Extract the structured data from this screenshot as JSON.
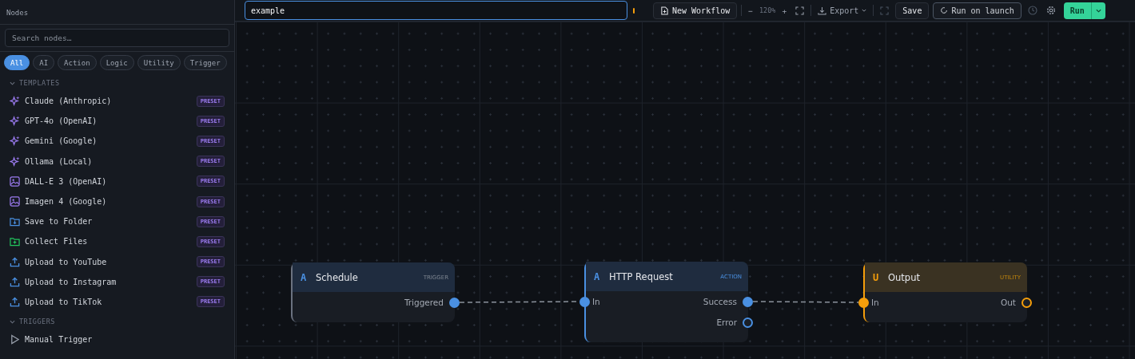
{
  "sidebar": {
    "title": "Nodes",
    "search": {
      "placeholder": "Search nodes…"
    },
    "filters": [
      {
        "label": "All",
        "selected": true
      },
      {
        "label": "AI",
        "selected": false
      },
      {
        "label": "Action",
        "selected": false
      },
      {
        "label": "Logic",
        "selected": false
      },
      {
        "label": "Utility",
        "selected": false
      },
      {
        "label": "Trigger",
        "selected": false
      }
    ],
    "sections": [
      {
        "label": "TEMPLATES",
        "expanded": true,
        "items": [
          {
            "label": "Claude (Anthropic)",
            "kind": "sparkle",
            "badge": "PRESET"
          },
          {
            "label": "GPT-4o (OpenAI)",
            "kind": "sparkle",
            "badge": "PRESET"
          },
          {
            "label": "Gemini (Google)",
            "kind": "sparkle",
            "badge": "PRESET"
          },
          {
            "label": "Ollama (Local)",
            "kind": "sparkle",
            "badge": "PRESET"
          },
          {
            "label": "DALL-E 3 (OpenAI)",
            "kind": "image",
            "badge": "PRESET"
          },
          {
            "label": "Imagen 4 (Google)",
            "kind": "image",
            "badge": "PRESET"
          },
          {
            "label": "Save to Folder",
            "kind": "folder-save",
            "badge": "PRESET"
          },
          {
            "label": "Collect Files",
            "kind": "folder-add",
            "badge": "PRESET"
          },
          {
            "label": "Upload to YouTube",
            "kind": "upload",
            "badge": "PRESET"
          },
          {
            "label": "Upload to Instagram",
            "kind": "upload",
            "badge": "PRESET"
          },
          {
            "label": "Upload to TikTok",
            "kind": "upload",
            "badge": "PRESET"
          }
        ]
      },
      {
        "label": "TRIGGERS",
        "expanded": true,
        "items": [
          {
            "label": "Manual Trigger",
            "kind": "play"
          }
        ]
      }
    ]
  },
  "toolbar": {
    "title_value": "example",
    "unsaved": true,
    "new_workflow": "New Workflow",
    "zoom_out": "−",
    "zoom": "120%",
    "zoom_in": "+",
    "export": "Export",
    "save": "Save",
    "run_on_launch": "Run on launch",
    "run": "Run"
  },
  "nodes": [
    {
      "letter": "A",
      "title": "Schedule",
      "kind": "trigger",
      "tag": "TRIGGER",
      "outputs": [
        {
          "label": "Triggered",
          "connected": true
        }
      ]
    },
    {
      "letter": "A",
      "title": "HTTP Request",
      "kind": "action",
      "tag": "ACTION",
      "inputs": [
        {
          "label": "In",
          "connected": true
        }
      ],
      "outputs": [
        {
          "label": "Success",
          "connected": true
        },
        {
          "label": "Error",
          "connected": false
        }
      ]
    },
    {
      "letter": "U",
      "title": "Output",
      "kind": "utility",
      "tag": "UTILITY",
      "inputs": [
        {
          "label": "In",
          "connected": true
        }
      ],
      "outputs": [
        {
          "label": "Out",
          "connected": false
        }
      ]
    }
  ]
}
